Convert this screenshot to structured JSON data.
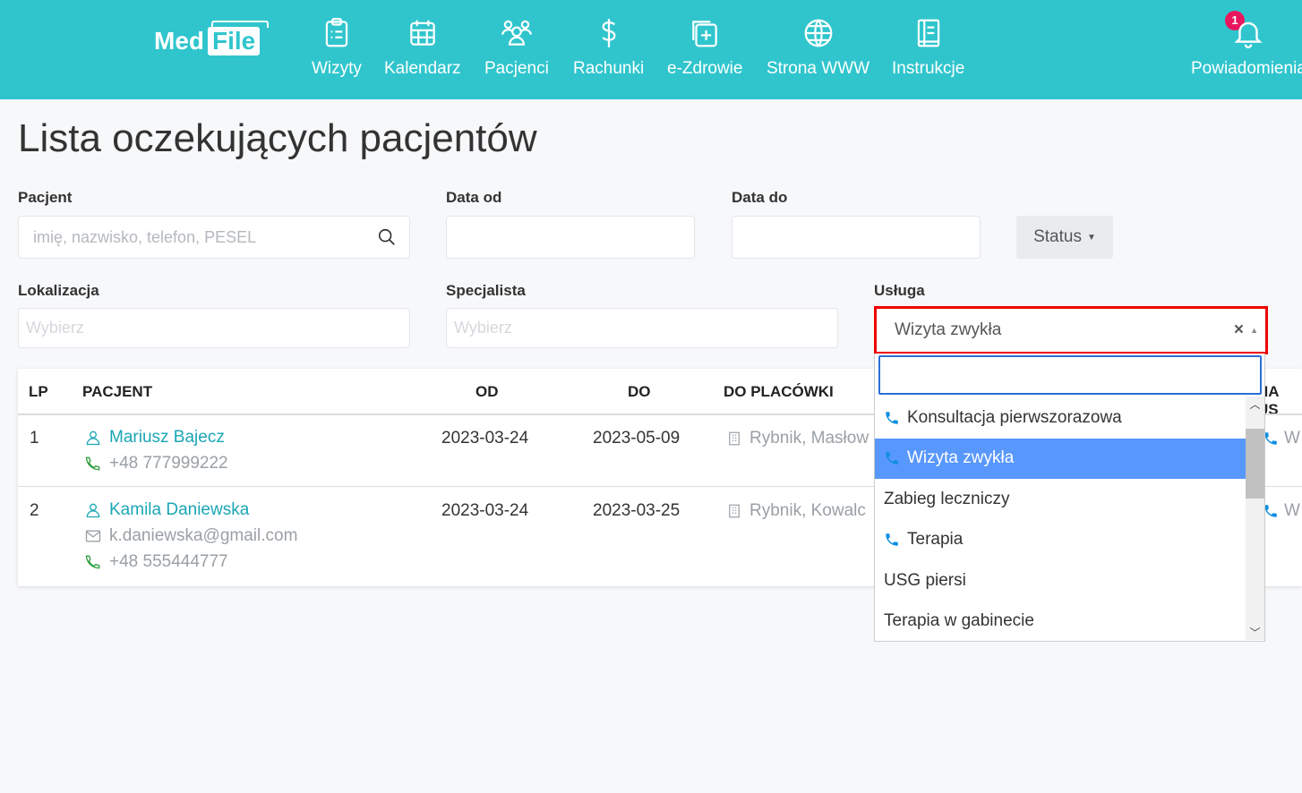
{
  "brand": {
    "med": "Med",
    "file": "File"
  },
  "nav": [
    {
      "label": "Wizyty",
      "icon": "clipboard-icon"
    },
    {
      "label": "Kalendarz",
      "icon": "calendar-icon"
    },
    {
      "label": "Pacjenci",
      "icon": "users-icon"
    },
    {
      "label": "Rachunki",
      "icon": "dollar-icon"
    },
    {
      "label": "e-Zdrowie",
      "icon": "medical-plus-icon"
    },
    {
      "label": "Strona WWW",
      "icon": "globe-icon"
    },
    {
      "label": "Instrukcje",
      "icon": "book-icon"
    }
  ],
  "notifications": {
    "label": "Powiadomienia",
    "count": "1"
  },
  "page_title": "Lista oczekujących pacjentów",
  "filters": {
    "patient_label": "Pacjent",
    "patient_placeholder": "imię, nazwisko, telefon, PESEL",
    "date_from_label": "Data od",
    "date_to_label": "Data do",
    "status_label": "Status",
    "location_label": "Lokalizacja",
    "location_placeholder": "Wybierz",
    "specialist_label": "Specjalista",
    "specialist_placeholder": "Wybierz",
    "service_label": "Usługa",
    "service_value": "Wizyta zwykła"
  },
  "table": {
    "headers": [
      "LP",
      "PACJENT",
      "OD",
      "DO",
      "DO PLACÓWKI",
      "NA US"
    ],
    "rows": [
      {
        "lp": "1",
        "name": "Mariusz Bajecz",
        "email": "",
        "phone": "+48 777999222",
        "from": "2023-03-24",
        "to": "2023-05-09",
        "place": "Rybnik, Masłow",
        "service": "W"
      },
      {
        "lp": "2",
        "name": "Kamila Daniewska",
        "email": "k.daniewska@gmail.com",
        "phone": "+48 555444777",
        "from": "2023-03-24",
        "to": "2023-03-25",
        "place": "Rybnik, Kowalc",
        "service": "W"
      }
    ]
  },
  "dropdown": {
    "options": [
      {
        "label": "Konsultacja pierwszorazowa",
        "phone": true
      },
      {
        "label": "Wizyta zwykła",
        "phone": true,
        "highlighted": true
      },
      {
        "label": "Zabieg leczniczy",
        "phone": false
      },
      {
        "label": "Terapia",
        "phone": true
      },
      {
        "label": "USG piersi",
        "phone": false
      },
      {
        "label": "Terapia w gabinecie",
        "phone": false
      }
    ]
  },
  "colors": {
    "header": "#30c5cd",
    "link": "#1aa6b5",
    "highlight": "#5897fb",
    "phone": "#0d8fe0",
    "focus_border": "#e00000"
  }
}
